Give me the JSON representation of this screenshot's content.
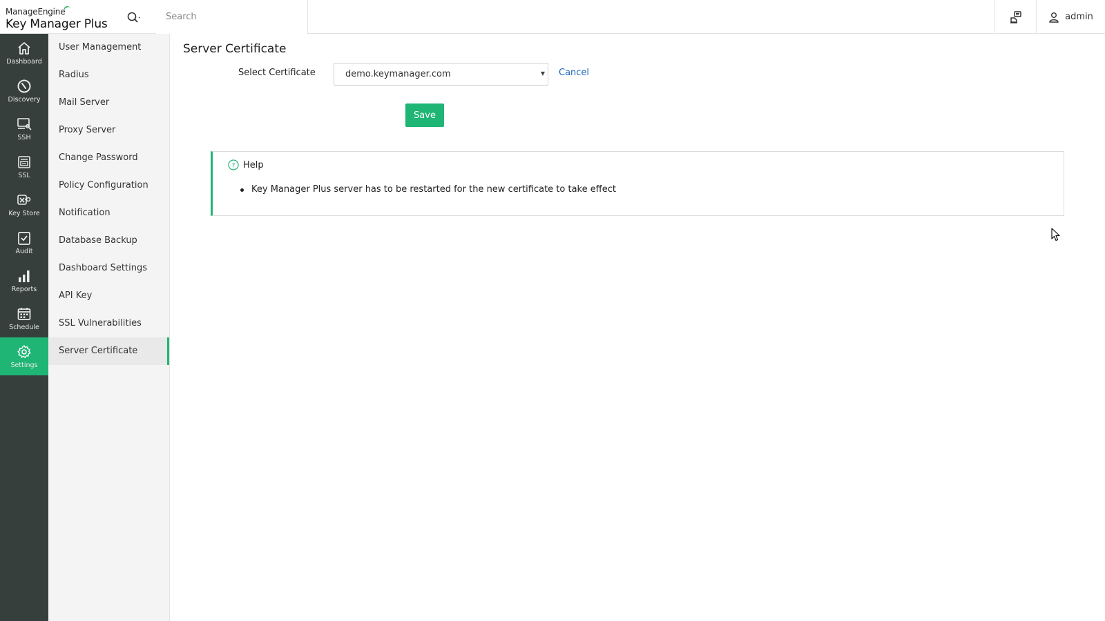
{
  "brand": {
    "top": "ManageEngine",
    "product": "Key Manager Plus",
    "accent": "#3bb36a"
  },
  "header": {
    "search_placeholder": "Search",
    "user_name": "admin"
  },
  "colors": {
    "accent": "#1fb574",
    "nav_bg": "#363f3b",
    "link": "#1a66b8"
  },
  "leftnav": [
    {
      "label": "Dashboard",
      "icon": "home-icon"
    },
    {
      "label": "Discovery",
      "icon": "compass-icon"
    },
    {
      "label": "SSH",
      "icon": "ssh-terminal-icon"
    },
    {
      "label": "SSL",
      "icon": "ssl-certificate-icon"
    },
    {
      "label": "Key Store",
      "icon": "key-store-icon"
    },
    {
      "label": "Audit",
      "icon": "audit-check-icon"
    },
    {
      "label": "Reports",
      "icon": "bar-chart-icon"
    },
    {
      "label": "Schedule",
      "icon": "calendar-icon"
    },
    {
      "label": "Settings",
      "icon": "gear-icon",
      "active": true
    }
  ],
  "subnav": [
    {
      "label": "User Management"
    },
    {
      "label": "Radius"
    },
    {
      "label": "Mail Server"
    },
    {
      "label": "Proxy Server"
    },
    {
      "label": "Change Password"
    },
    {
      "label": "Policy Configuration"
    },
    {
      "label": "Notification"
    },
    {
      "label": "Database Backup"
    },
    {
      "label": "Dashboard Settings"
    },
    {
      "label": "API Key"
    },
    {
      "label": "SSL Vulnerabilities"
    },
    {
      "label": "Server Certificate",
      "active": true
    }
  ],
  "main": {
    "title": "Server Certificate",
    "select_label": "Select Certificate",
    "select_value": "demo.keymanager.com",
    "cancel_label": "Cancel",
    "save_label": "Save",
    "help": {
      "title": "Help",
      "items": [
        "Key Manager Plus server has to be restarted for the new certificate to take effect"
      ]
    }
  }
}
